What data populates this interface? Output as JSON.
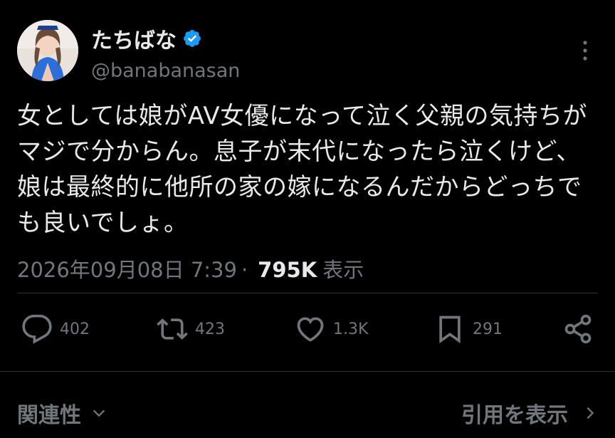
{
  "author": {
    "display_name": "たちばな",
    "handle": "@banabanasan",
    "verified_icon": "verified-badge-icon",
    "accent_color": "#1d9bf0"
  },
  "tweet": {
    "text": "女としては娘がAV女優になって泣く父親の気持ちがマジで分からん。息子が末代になったら泣くけど、娘は最終的に他所の家の嫁になるんだからどっちでも良いでしょ。"
  },
  "meta": {
    "timestamp": "2026年09月08日 7:39",
    "separator": "·",
    "views_count": "795K",
    "views_label": "表示"
  },
  "actions": {
    "replies": "402",
    "reposts": "423",
    "likes": "1.3K",
    "bookmarks": "291"
  },
  "footer": {
    "related_label": "関連性",
    "quotes_label": "引用を表示"
  }
}
